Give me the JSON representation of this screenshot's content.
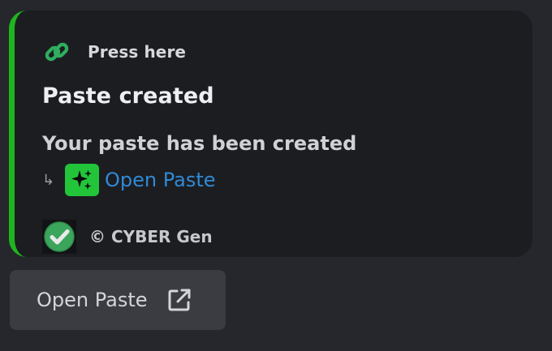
{
  "embed": {
    "accent_color": "#1fb51f",
    "author": {
      "icon": "chain-link-icon",
      "text": "Press here"
    },
    "title": "Paste created",
    "description": "Your paste has been created",
    "link": {
      "arrow": "↳",
      "icon": "sparkle-icon",
      "text": "Open Paste",
      "color": "#2f8ad6"
    },
    "footer": {
      "icon": "checkmark-badge-icon",
      "text": "© CYBER Gen"
    }
  },
  "button": {
    "label": "Open Paste",
    "icon": "external-link-icon"
  }
}
